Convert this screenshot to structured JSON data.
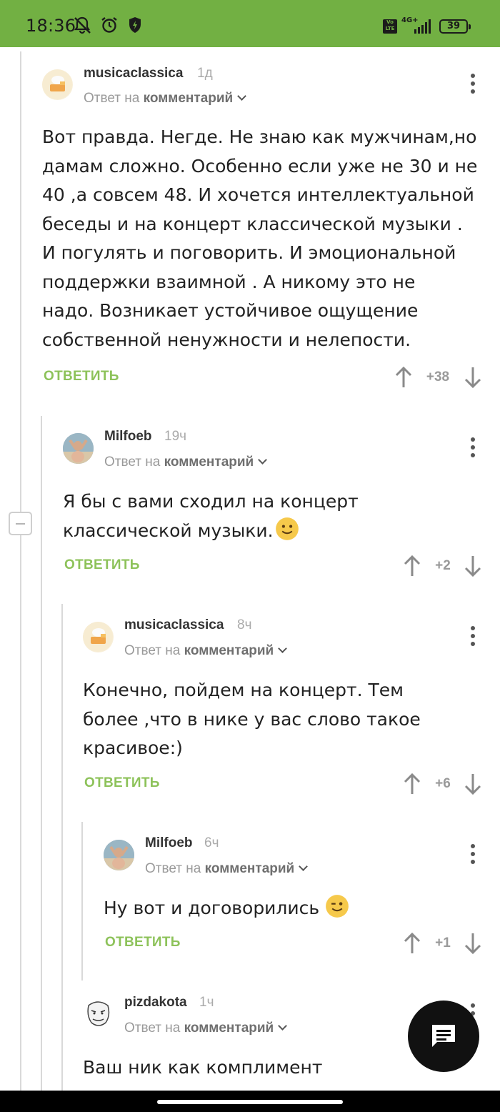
{
  "status_bar": {
    "time": "18:36",
    "network": "4G+",
    "volte": "Vo LTE",
    "battery": "39"
  },
  "comments": [
    {
      "username": "musicaclassica",
      "age": "1д",
      "reply_prefix": "Ответ на",
      "reply_target": "комментарий",
      "text": "Вот правда. Негде. Не знаю как мужчинам,но\nдамам сложно. Особенно если уже не 30 и не\n40 ,а совсем 48. И хочется интеллектуальной\nбеседы и на концерт классической музыки .\nИ погулять и поговорить. И  эмоциональной\nподдержки взаимной . А никому это не\nнадо. Возникает устойчивое ощущение\nсобственной  ненужности и нелепости.",
      "reply_label": "ОТВЕТИТЬ",
      "score": "+38"
    },
    {
      "username": "Milfoeb",
      "age": "19ч",
      "reply_prefix": "Ответ на",
      "reply_target": "комментарий",
      "text": "Я бы с вами сходил на концерт\nклассической музыки.",
      "reply_label": "ОТВЕТИТЬ",
      "score": "+2"
    },
    {
      "username": "musicaclassica",
      "age": "8ч",
      "reply_prefix": "Ответ на",
      "reply_target": "комментарий",
      "text": "Конечно, пойдем на концерт. Тем\nболее ,что в нике у вас слово такое\nкрасивое:)",
      "reply_label": "ОТВЕТИТЬ",
      "score": "+6"
    },
    {
      "username": "Milfoeb",
      "age": "6ч",
      "reply_prefix": "Ответ на",
      "reply_target": "комментарий",
      "text": "Ну вот и договорились",
      "reply_label": "ОТВЕТИТЬ",
      "score": "+1"
    },
    {
      "username": "pizdakota",
      "age": "1ч",
      "reply_prefix": "Ответ на",
      "reply_target": "комментарий",
      "text": "Ваш ник как комплимент"
    }
  ],
  "colors": {
    "status_bar": "#72b043",
    "reply_button": "#8dc25a",
    "fab": "#111111"
  },
  "icons": {
    "fab": "chat-icon"
  }
}
